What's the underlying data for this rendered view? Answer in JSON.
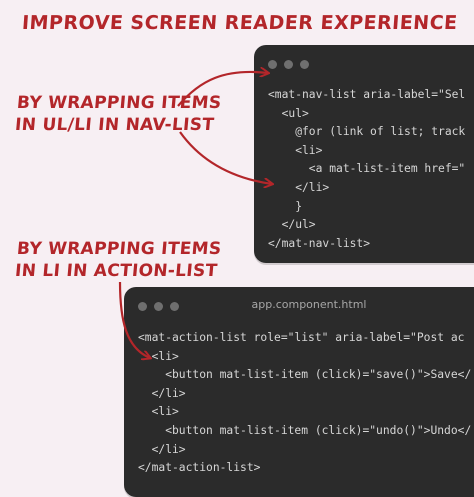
{
  "headline": "IMPROVE SCREEN READER EXPERIENCE",
  "callouts": {
    "nav_line1": "BY WRAPPING ITEMS",
    "nav_line2": "IN UL/LI IN NAV-LIST",
    "action_line1": "BY WRAPPING ITEMS",
    "action_line2": "IN LI IN ACTION-LIST"
  },
  "window_nav": {
    "lines": [
      "<mat-nav-list aria-label=\"Sel",
      "  <ul>",
      "    @for (link of list; track",
      "    <li>",
      "      <a mat-list-item href=\"",
      "    </li>",
      "    }",
      "  </ul>",
      "</mat-nav-list>"
    ]
  },
  "window_action": {
    "title": "app.component.html",
    "lines": [
      "<mat-action-list role=\"list\" aria-label=\"Post ac",
      "  <li>",
      "    <button mat-list-item (click)=\"save()\">Save</",
      "  </li>",
      "  <li>",
      "    <button mat-list-item (click)=\"undo()\">Undo</",
      "  </li>",
      "</mat-action-list>"
    ]
  },
  "colors": {
    "accent": "#b3262a",
    "background": "#f7eff3",
    "editor": "#2b2b2b"
  }
}
